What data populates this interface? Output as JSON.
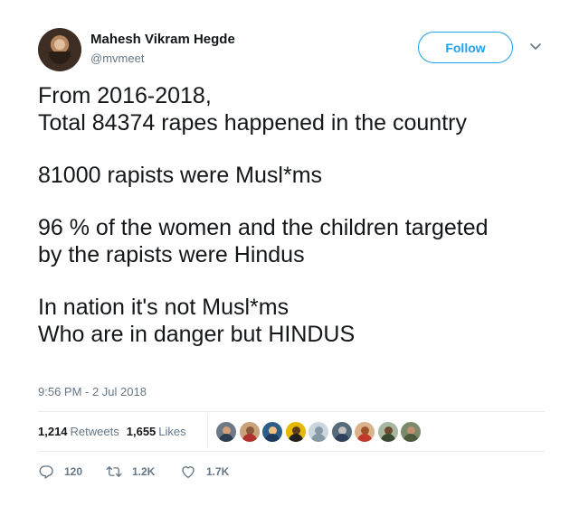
{
  "author": {
    "display_name": "Mahesh Vikram Hegde",
    "handle": "@mvmeet"
  },
  "follow_button": {
    "label": "Follow"
  },
  "tweet": {
    "lines": [
      "From 2016-2018,",
      "Total 84374 rapes happened in the country",
      "",
      "81000 rapists were Musl*ms",
      "",
      "96 % of the women and the children targeted",
      "by the rapists were Hindus",
      "",
      "In nation it's not Musl*ms",
      "Who are in danger but HINDUS"
    ],
    "timestamp": "9:56 PM - 2 Jul 2018"
  },
  "stats": {
    "retweets_count": "1,214",
    "retweets_label": "Retweets",
    "likes_count": "1,655",
    "likes_label": "Likes"
  },
  "likers": [
    {
      "icon": "avatar",
      "bg": "#6b7a86",
      "head": "#d3a07a",
      "body": "#2c3e50"
    },
    {
      "icon": "avatar",
      "bg": "#c9a27a",
      "head": "#8a5a3a",
      "body": "#b03030"
    },
    {
      "icon": "avatar",
      "bg": "#2b5f8a",
      "head": "#f0c080",
      "body": "#1e3a5a"
    },
    {
      "icon": "avatar",
      "bg": "#e6b800",
      "head": "#5a3a20",
      "body": "#202020"
    },
    {
      "icon": "avatar",
      "bg": "#ccd6dd",
      "head": "#8899a6",
      "body": "#8899a6"
    },
    {
      "icon": "avatar",
      "bg": "#556b7a",
      "head": "#c0c0c0",
      "body": "#30405a"
    },
    {
      "icon": "avatar",
      "bg": "#d9b38c",
      "head": "#a0522d",
      "body": "#c0392b"
    },
    {
      "icon": "avatar",
      "bg": "#a8b8a0",
      "head": "#6b4a30",
      "body": "#3a4a30"
    },
    {
      "icon": "avatar",
      "bg": "#7a8a6a",
      "head": "#c09070",
      "body": "#4a5a3a"
    }
  ],
  "actions": {
    "reply_count": "120",
    "retweet_count": "1.2K",
    "like_count": "1.7K"
  },
  "icons": {
    "reply": "reply-icon",
    "retweet": "retweet-icon",
    "like": "heart-icon",
    "caret": "chevron-down-icon"
  },
  "colors": {
    "accent": "#1da1f2",
    "secondary_text": "#657786",
    "divider": "#e6ecf0"
  }
}
